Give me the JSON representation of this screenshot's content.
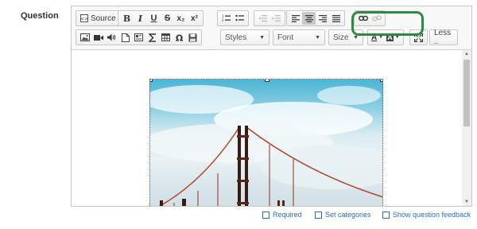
{
  "question_label": "Question",
  "toolbar": {
    "source_label": "Source",
    "bold": "B",
    "italic": "I",
    "underline": "U",
    "strike": "S",
    "subscript": "x₂",
    "superscript": "x²",
    "styles_label": "Styles",
    "font_label": "Font",
    "size_label": "Size",
    "text_color": "A",
    "bg_color": "A",
    "less_label": "Less .."
  },
  "checkboxes": {
    "required": "Required",
    "set_categories": "Set categories",
    "show_feedback": "Show question feedback"
  },
  "colors": {
    "highlight": "#2e8a3e",
    "link_text": "#2a6ebb"
  },
  "icons": {
    "source": "source-icon",
    "numbered_list": "numbered-list-icon",
    "bulleted_list": "bulleted-list-icon",
    "outdent": "outdent-icon",
    "indent": "indent-icon",
    "align_left": "align-left-icon",
    "align_center": "align-center-icon",
    "align_right": "align-right-icon",
    "justify": "justify-icon",
    "link": "link-icon",
    "unlink": "unlink-icon",
    "image": "image-icon",
    "video": "video-icon",
    "audio": "audio-icon",
    "document": "document-icon",
    "template": "template-icon",
    "sigma": "sigma-icon",
    "table": "table-icon",
    "omega": "omega-icon",
    "save": "save-icon",
    "maximize": "maximize-icon"
  },
  "editor_state": {
    "active_alignment": "center"
  }
}
